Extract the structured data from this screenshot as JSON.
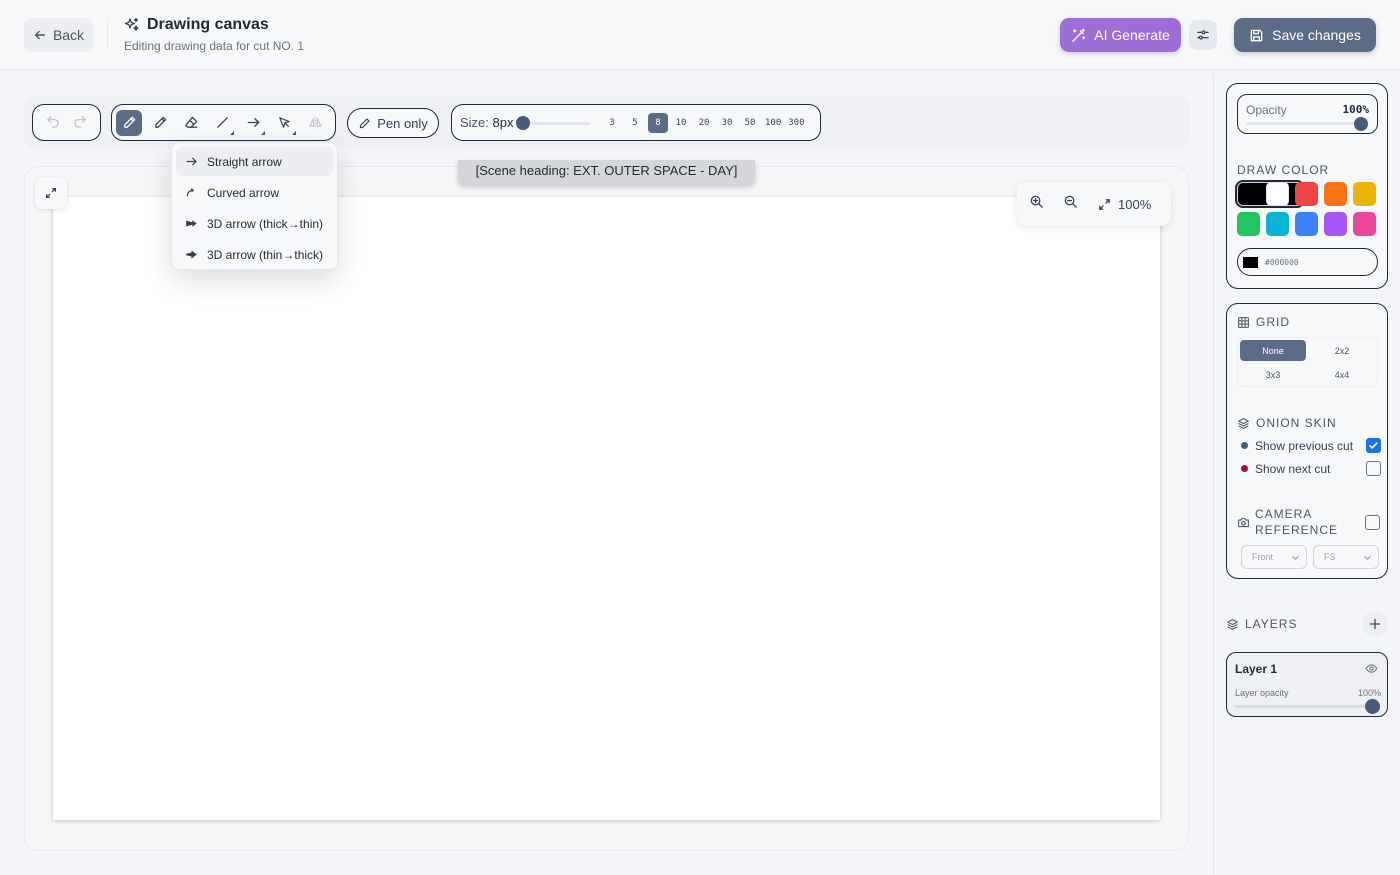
{
  "header": {
    "back_label": "Back",
    "title": "Drawing canvas",
    "subtitle": "Editing drawing data for cut NO. 1",
    "ai_label": "AI Generate",
    "save_label": "Save changes"
  },
  "toolbar": {
    "tools": [
      "pen",
      "pencil",
      "eraser",
      "line",
      "arrow",
      "lasso",
      "flip"
    ],
    "active_tool": "pen",
    "pen_only_label": "Pen only",
    "size_prefix": "Size:",
    "size_value": "8px",
    "size_options": [
      "3",
      "5",
      "8",
      "10",
      "20",
      "30",
      "50",
      "100",
      "300"
    ],
    "size_selected": "8"
  },
  "arrow_menu": {
    "items": [
      {
        "label": "Straight arrow",
        "icon": "arrow-right-icon"
      },
      {
        "label": "Curved arrow",
        "icon": "curved-arrow-icon"
      },
      {
        "label": "3D arrow (thick→thin)",
        "icon": "arrow-3d-thick-thin-icon"
      },
      {
        "label": "3D arrow (thin→thick)",
        "icon": "arrow-3d-thin-thick-icon"
      }
    ]
  },
  "canvas": {
    "scene_heading": "[Scene heading: EXT. OUTER SPACE - DAY]",
    "zoom": "100%"
  },
  "sidebar": {
    "opacity_label": "Opacity",
    "opacity_value": "100%",
    "opacity_level": 1.0,
    "draw_color_label": "DRAW COLOR",
    "colors": [
      "#000000",
      "#ffffff",
      "#ef4444",
      "#f97316",
      "#eab308",
      "#22c55e",
      "#06b6d4",
      "#3b82f6",
      "#a855f7",
      "#ec4899"
    ],
    "selected_color": "#000000",
    "hex_value": "#000000",
    "grid_label": "GRID",
    "grid_options": [
      "None",
      "2x2",
      "3x3",
      "4x4"
    ],
    "grid_selected": "None",
    "onion_label": "ONION SKIN",
    "show_prev_label": "Show previous cut",
    "show_prev_checked": true,
    "show_next_label": "Show next cut",
    "show_next_checked": false,
    "camera_label": "CAMERA REFERENCE",
    "camera_checked": false,
    "camera_angle": "Front",
    "camera_shot": "FS"
  },
  "layers": {
    "label": "LAYERS",
    "items": [
      {
        "name": "Layer 1",
        "opacity_label": "Layer opacity",
        "opacity_value": "100%",
        "opacity_level": 1.0
      }
    ]
  },
  "theme": {
    "accent": "#5c6b86",
    "ai_purple": "#9b6fd6",
    "prev_dot": "#475a78",
    "next_dot": "#9f1239",
    "checkbox_blue": "#1a73e8"
  }
}
